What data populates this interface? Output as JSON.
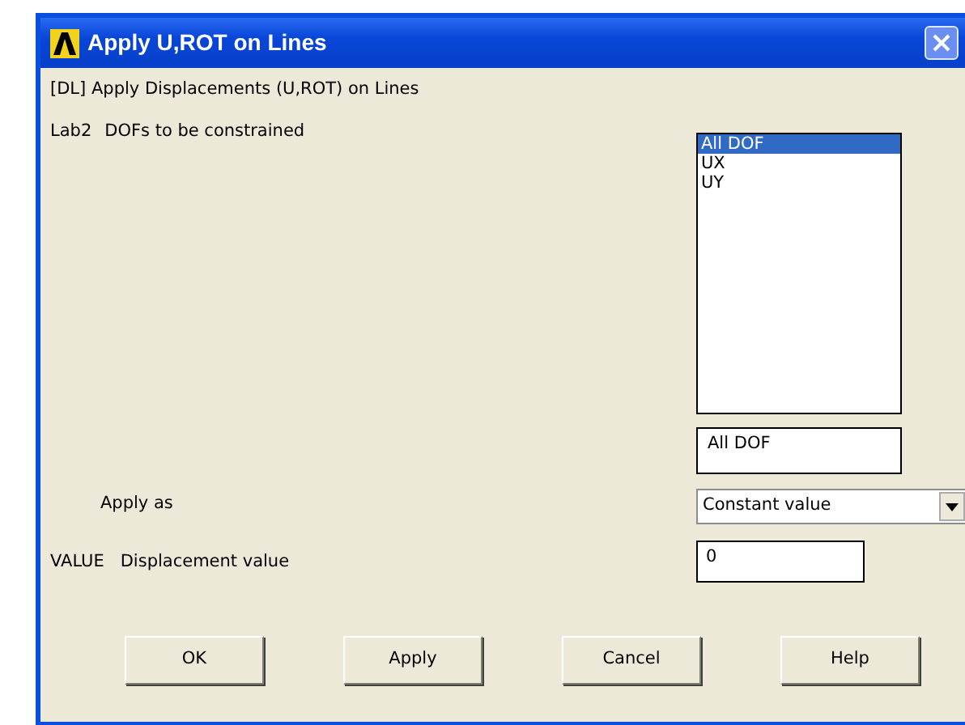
{
  "window": {
    "title": "Apply U,ROT on Lines"
  },
  "heading": "[DL]  Apply Displacements (U,ROT) on Lines",
  "dofs": {
    "code": "Lab2",
    "label": "DOFs to be constrained",
    "options": [
      {
        "label": "All DOF",
        "selected": true
      },
      {
        "label": "UX",
        "selected": false
      },
      {
        "label": "UY",
        "selected": false
      }
    ],
    "value": "All DOF"
  },
  "apply_as": {
    "label": "Apply as",
    "value": "Constant value"
  },
  "displacement": {
    "code": "VALUE",
    "label": "Displacement value",
    "value": "0"
  },
  "buttons": [
    "OK",
    "Apply",
    "Cancel",
    "Help"
  ]
}
